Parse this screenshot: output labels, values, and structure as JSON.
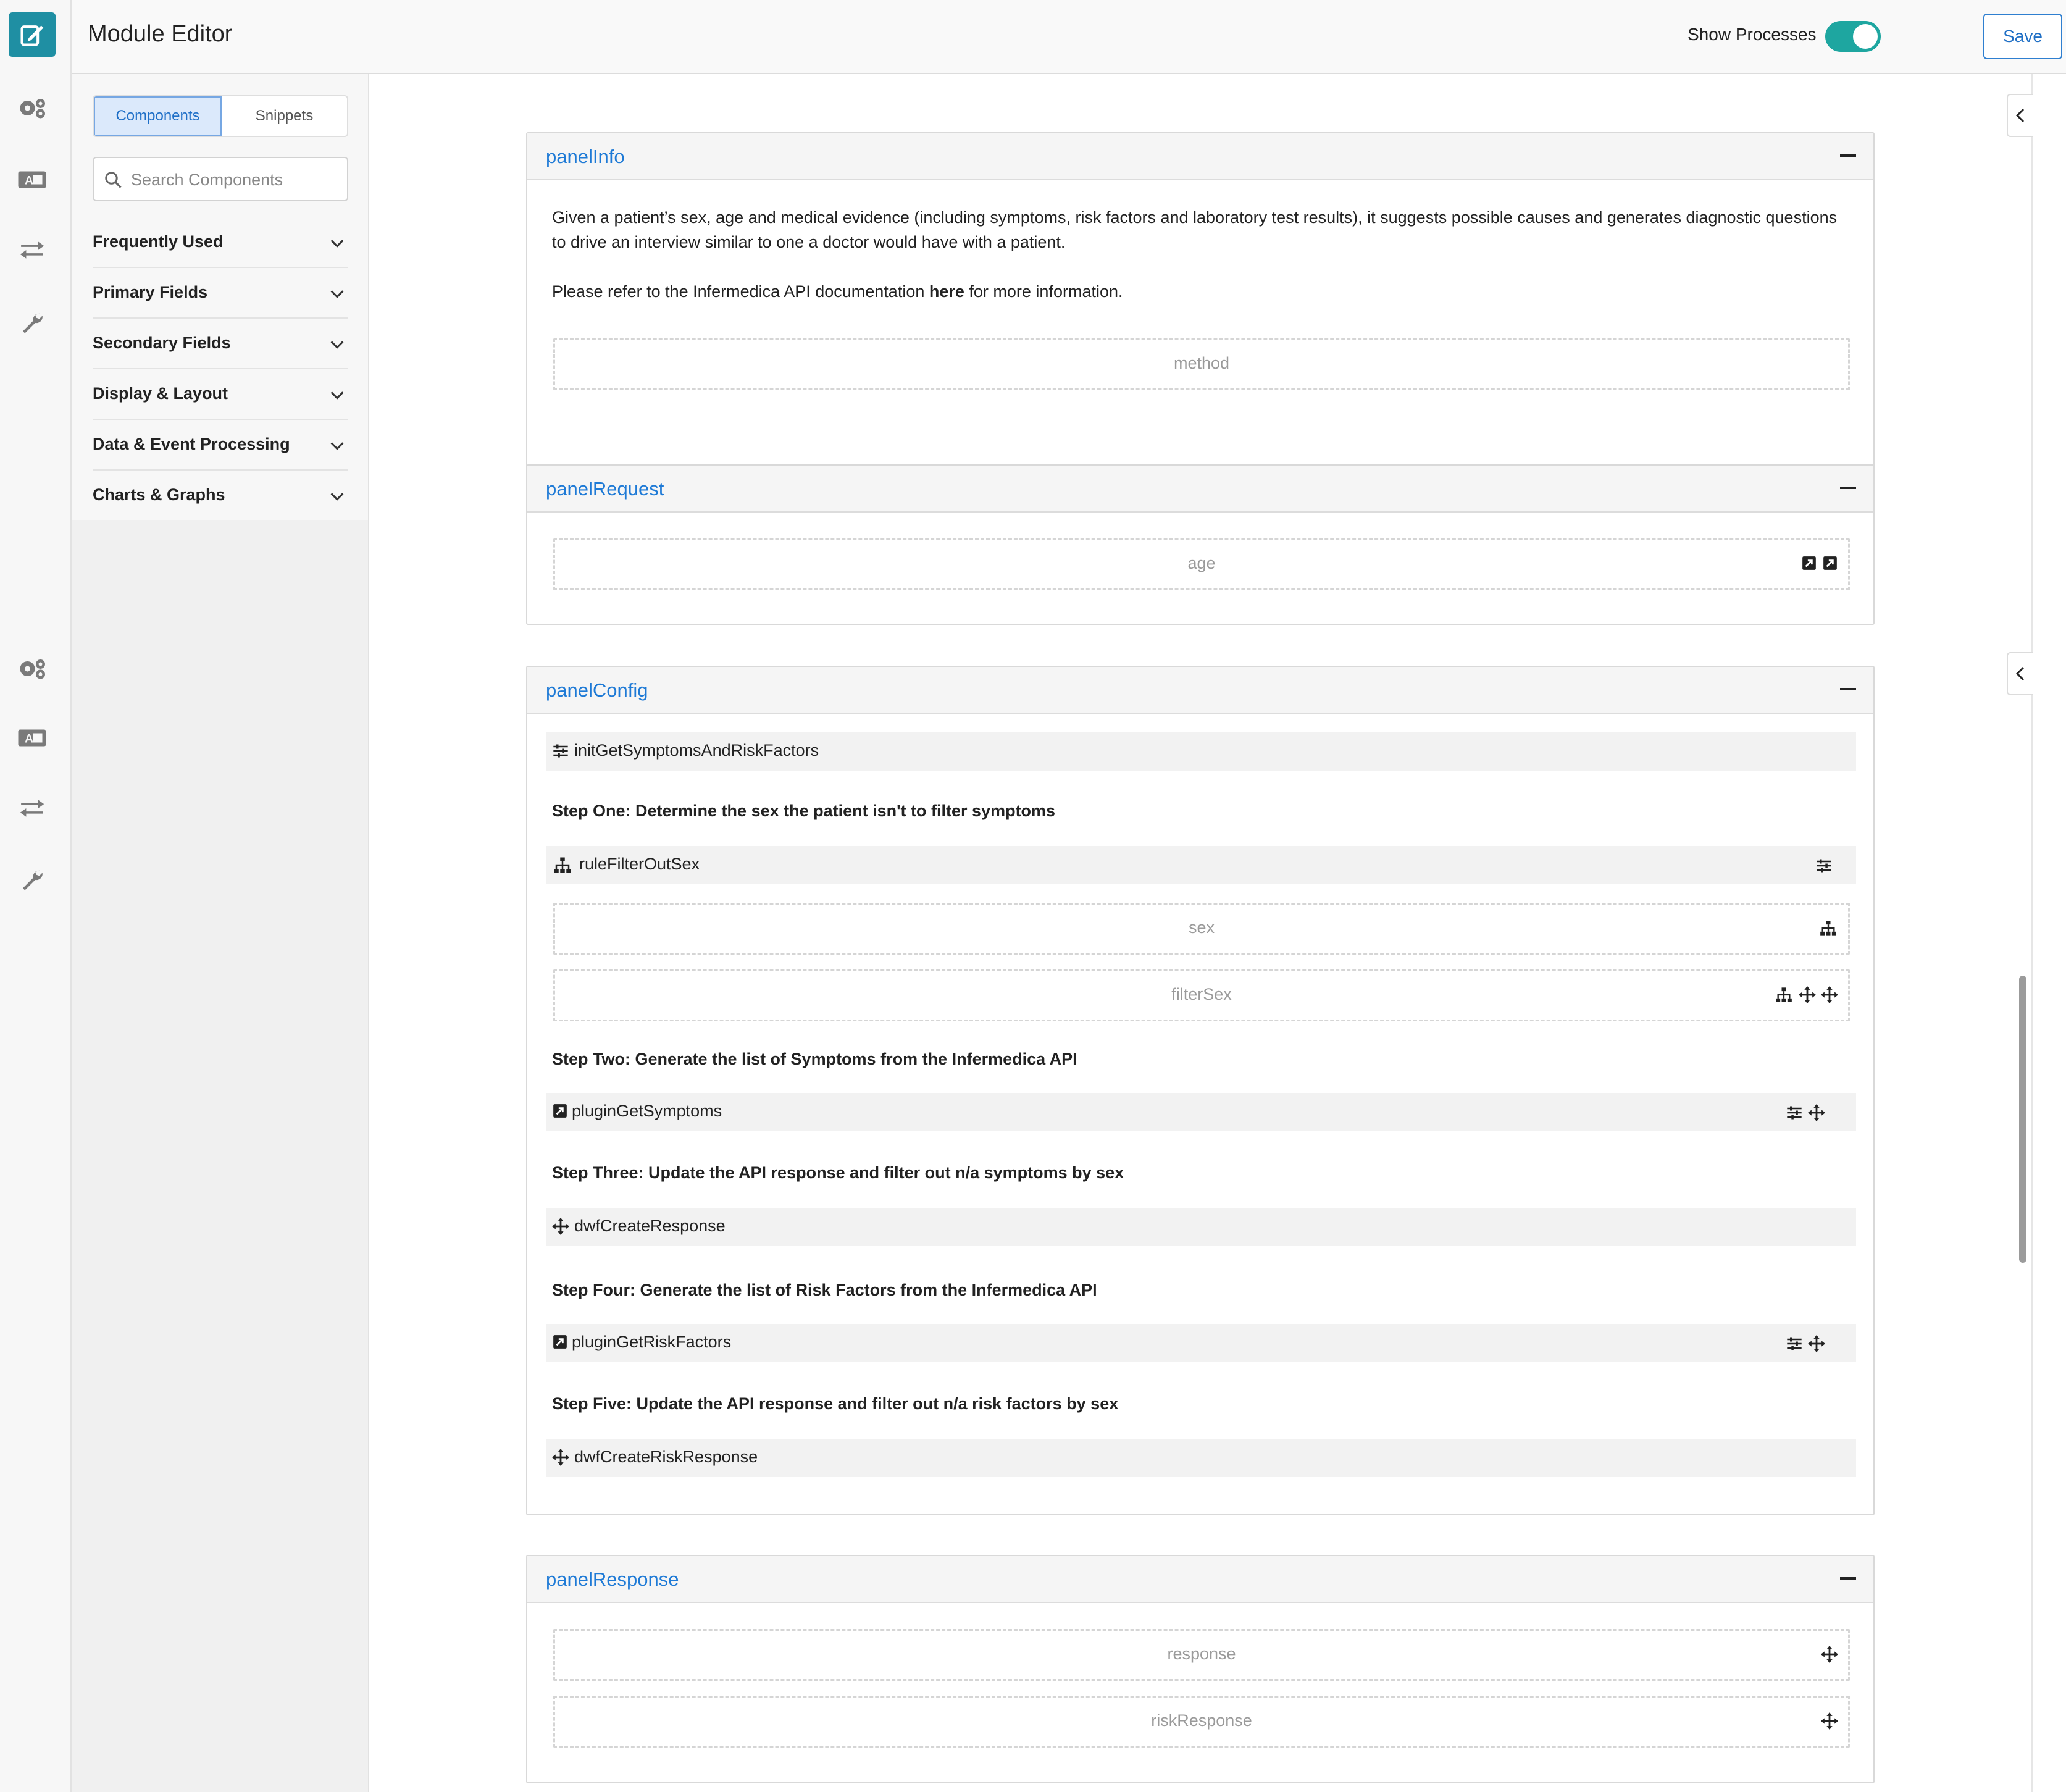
{
  "header": {
    "title": "Module Editor",
    "show_processes_label": "Show Processes",
    "show_processes_on": true,
    "save_label": "Save",
    "more_label": "•••"
  },
  "colors": {
    "accent": "#1f8fa3",
    "toggle": "#1ea6a0",
    "link": "#1e7ad6"
  },
  "rail": {
    "top_icons": [
      "edit-icon",
      "gears-icon",
      "text-box-icon",
      "transfer-arrows-icon",
      "wrench-icon"
    ],
    "bottom_icons": [
      "gears-icon",
      "text-box-icon",
      "transfer-arrows-icon",
      "wrench-icon"
    ]
  },
  "sidebar": {
    "tabs": [
      "Components",
      "Snippets"
    ],
    "active_tab": "Components",
    "search_placeholder": "Search Components",
    "categories": [
      "Frequently Used",
      "Primary Fields",
      "Secondary Fields",
      "Display & Layout",
      "Data & Event Processing",
      "Charts & Graphs"
    ]
  },
  "panels": {
    "info": {
      "title": "panelInfo",
      "description": "Given a patient’s sex, age and medical evidence (including symptoms, risk factors and laboratory test results), it suggests possible causes and generates diagnostic questions to drive an interview similar to one a doctor would have with a patient.",
      "refer_before": "Please refer to the Infermedica API documentation ",
      "refer_link": "here",
      "refer_after": " for more information.",
      "field": "method"
    },
    "request": {
      "title": "panelRequest",
      "field": "age"
    },
    "config": {
      "title": "panelConfig",
      "init": "initGetSymptomsAndRiskFactors",
      "step1": "Step One: Determine the sex the patient isn't to filter symptoms",
      "rule": "ruleFilterOutSex",
      "field_sex": "sex",
      "field_filter": "filterSex",
      "step2": "Step Two: Generate the list of Symptoms from the Infermedica API",
      "plugin1": "pluginGetSymptoms",
      "step3": "Step Three: Update the API response and filter out n/a symptoms by sex",
      "dwf1": "dwfCreateResponse",
      "step4": "Step Four: Generate the list of Risk Factors from the Infermedica API",
      "plugin2": "pluginGetRiskFactors",
      "step5": "Step Five: Update the API response and filter out n/a risk factors by sex",
      "dwf2": "dwfCreateRiskResponse"
    },
    "response": {
      "title": "panelResponse",
      "field1": "response",
      "field2": "riskResponse"
    }
  }
}
